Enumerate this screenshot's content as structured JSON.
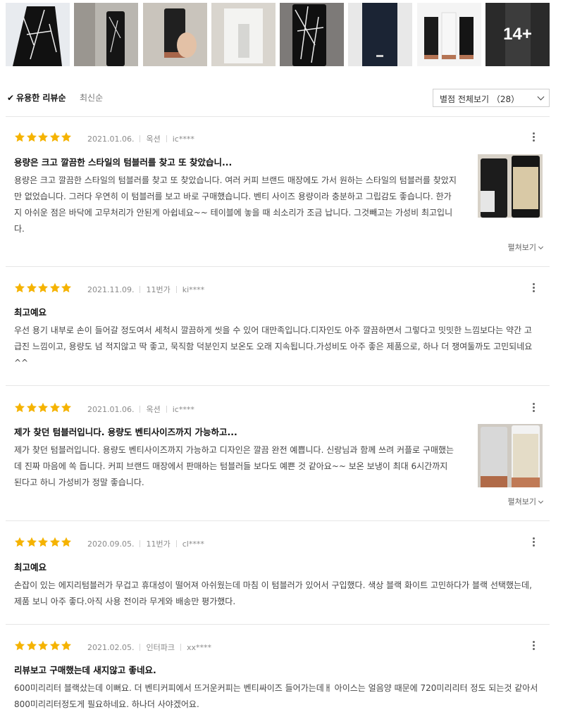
{
  "thumbnails": {
    "more_label": "14+",
    "items": [
      {
        "name": "thumb-marble-tumbler"
      },
      {
        "name": "thumb-tumbler-kitchen"
      },
      {
        "name": "thumb-black-tumbler-hand"
      },
      {
        "name": "thumb-tumbler-box"
      },
      {
        "name": "thumb-marble-tumbler-hand"
      },
      {
        "name": "thumb-navy-tumbler"
      },
      {
        "name": "thumb-three-tumblers"
      },
      {
        "name": "thumb-black-tumbler-closeup"
      }
    ]
  },
  "sort": {
    "helpful_label": "유용한 리뷰순",
    "latest_label": "최신순",
    "option_select": "별점 전체보기 （28）"
  },
  "colors": {
    "star": "#f5b301",
    "accent": "#222222"
  },
  "reviews": [
    {
      "rating": 5,
      "date": "2021.01.06.",
      "mall": "옥션",
      "user": "ic****",
      "title": "용량은 크고 깔끔한 스타일의 텀블러를 찾고 또 찾았습니...",
      "body": "용량은 크고 깔끔한 스타일의 텀블러를 찾고 또 찾았습니다. 여러 커피 브랜드 매장에도 가서 원하는 스타일의 텀블러를 찾았지만 없었습니다. 그러다 우연히 이 텀블러를 보고 바로 구매했습니다. 벤티 사이즈 용량이라 충분하고 그립감도 좋습니다. 한가지 아쉬운 점은 바닥에 고무처리가 안된게 아쉽네요~~ 테이블에 놓을 때 쇠소리가 조금 납니다. 그것빼고는 가성비 최고입니다.",
      "expand_label": "펼쳐보기"
    },
    {
      "rating": 5,
      "date": "2021.11.09.",
      "mall": "11번가",
      "user": "ki****",
      "title": "최고예요",
      "body": "우선 용기 내부로 손이 들어갈 정도여서 세척시 깔끔하게 씻을 수 있어 대만족입니다.디자인도 아주 깔끔하면서 그렇다고 밋밋한 느낌보다는 약간 고급진 느낌이고, 용량도 넘 적지않고 딱 좋고, 묵직함 덕분인지 보온도 오래 지속됩니다.가성비도 아주 좋은 제품으로, 하나 더 쟁여둘까도 고민되네요^^"
    },
    {
      "rating": 5,
      "date": "2021.01.06.",
      "mall": "옥션",
      "user": "ic****",
      "title": "제가 찾던 텀블러입니다. 용량도 벤티사이즈까지 가능하고...",
      "body": "제가 찾던 텀블러입니다. 용량도 벤티사이즈까지 가능하고 디자인은 깔끔 완전 예쁩니다. 신랑님과 함께 쓰려 커플로 구매했는데 진짜 마음에 쏙 듭니다. 커피 브랜드 매장에서 판매하는 텀블러들 보다도 예쁜 것 같아요~~ 보온 보냉이 최대 6시간까지 된다고 하니 가성비가 정말 좋습니다.",
      "expand_label": "펼쳐보기"
    },
    {
      "rating": 5,
      "date": "2020.09.05.",
      "mall": "11번가",
      "user": "cl****",
      "title": "최고예요",
      "body": "손잡이 있는 에지리텀블러가 무겁고 휴대성이 떨어져 아쉬웠는데 마침 이 텀블러가 있어서 구입했다. 색상 블랙 화이트 고민하다가 블랙 선택했는데, 제품 보니 아주 좋다.아직 사용 전이라 무게와 배송만 평가했다."
    },
    {
      "rating": 5,
      "date": "2021.02.05.",
      "mall": "인터파크",
      "user": "xx****",
      "title": "리뷰보고 구매했는데 새지않고 좋네요.",
      "body": "600미리리터 블랙샀는데 이뻐요. 더 벤티커피에서 뜨거운커피는 벤티싸이즈 들어가는데ㅐ 아이스는 얼음양 때문에 720미리리터 정도 되는것 같아서 800미리리터정도게 필요하네요. 하나더 사야겠어요."
    }
  ]
}
